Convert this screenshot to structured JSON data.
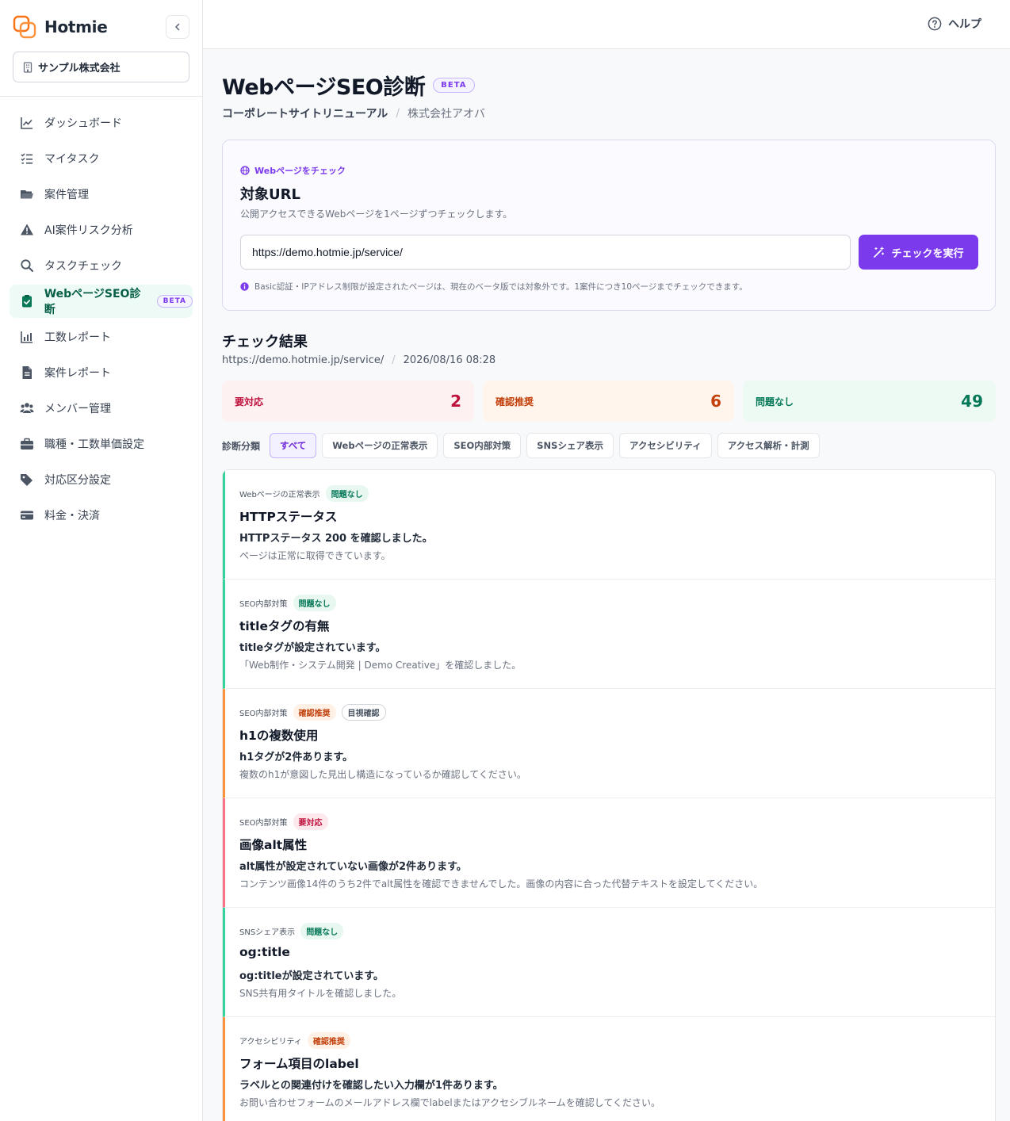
{
  "app": {
    "name": "Hotmie"
  },
  "sidebar": {
    "org": "サンプル株式会社",
    "items": [
      {
        "label": "ダッシュボード",
        "icon": "chart-line-icon"
      },
      {
        "label": "マイタスク",
        "icon": "checklist-icon"
      },
      {
        "label": "案件管理",
        "icon": "folder-icon"
      },
      {
        "label": "AI案件リスク分析",
        "icon": "warning-icon"
      },
      {
        "label": "タスクチェック",
        "icon": "search-icon"
      },
      {
        "label": "WebページSEO診断",
        "icon": "clipboard-check-icon",
        "badge": "BETA",
        "active": true
      },
      {
        "label": "工数レポート",
        "icon": "bar-chart-icon"
      },
      {
        "label": "案件レポート",
        "icon": "document-icon"
      },
      {
        "label": "メンバー管理",
        "icon": "users-icon"
      },
      {
        "label": "職種・工数単価設定",
        "icon": "briefcase-icon"
      },
      {
        "label": "対応区分設定",
        "icon": "tags-icon"
      },
      {
        "label": "料金・決済",
        "icon": "credit-card-icon"
      }
    ]
  },
  "header": {
    "help_label": "ヘルプ"
  },
  "page": {
    "title": "WebページSEO診断",
    "beta": "BETA",
    "project": "コーポレートサイトリニューアル",
    "separator": "/",
    "client": "株式会社アオバ"
  },
  "check": {
    "eyebrow": "Webページをチェック",
    "title": "対象URL",
    "description": "公開アクセスできるWebページを1ページずつチェックします。",
    "url_value": "https://demo.hotmie.jp/service/",
    "button_label": "チェックを実行",
    "note": "Basic認証・IPアドレス制限が設定されたページは、現在のベータ版では対象外です。1案件につき10ページまでチェックできます。"
  },
  "results": {
    "title": "チェック結果",
    "url": "https://demo.hotmie.jp/service/",
    "timestamp": "2026/08/16 08:28",
    "stats": {
      "action_required": {
        "label": "要対応",
        "value": 2
      },
      "review_recommended": {
        "label": "確認推奨",
        "value": 6
      },
      "no_issue": {
        "label": "問題なし",
        "value": 49
      }
    },
    "filter_label": "診断分類",
    "filters": [
      "すべて",
      "Webページの正常表示",
      "SEO内部対策",
      "SNSシェア表示",
      "アクセシビリティ",
      "アクセス解析・計測"
    ],
    "items": [
      {
        "category": "Webページの正常表示",
        "status": "問題なし",
        "severity": "ok",
        "title": "HTTPステータス",
        "summary": "HTTPステータス 200 を確認しました。",
        "detail": "ページは正常に取得できています。"
      },
      {
        "category": "SEO内部対策",
        "status": "問題なし",
        "severity": "ok",
        "title": "titleタグの有無",
        "summary": "titleタグが設定されています。",
        "detail": "「Web制作・システム開発 | Demo Creative」を確認しました。"
      },
      {
        "category": "SEO内部対策",
        "status": "確認推奨",
        "severity": "warn",
        "tag": "目視確認",
        "title": "h1の複数使用",
        "summary": "h1タグが2件あります。",
        "detail": "複数のh1が意図した見出し構造になっているか確認してください。"
      },
      {
        "category": "SEO内部対策",
        "status": "要対応",
        "severity": "danger",
        "title": "画像alt属性",
        "summary": "alt属性が設定されていない画像が2件あります。",
        "detail": "コンテンツ画像14件のうち2件でalt属性を確認できませんでした。画像の内容に合った代替テキストを設定してください。"
      },
      {
        "category": "SNSシェア表示",
        "status": "問題なし",
        "severity": "ok",
        "title": "og:title",
        "summary": "og:titleが設定されています。",
        "detail": "SNS共有用タイトルを確認しました。"
      },
      {
        "category": "アクセシビリティ",
        "status": "確認推奨",
        "severity": "warn",
        "title": "フォーム項目のlabel",
        "summary": "ラベルとの関連付けを確認したい入力欄が1件あります。",
        "detail": "お問い合わせフォームのメールアドレス欄でlabelまたはアクセシブルネームを確認してください。"
      }
    ]
  },
  "colors": {
    "accent": "#7c3aed",
    "ok": "#047857",
    "warn": "#c2410c",
    "danger": "#be123c",
    "brand": "#f97316"
  }
}
